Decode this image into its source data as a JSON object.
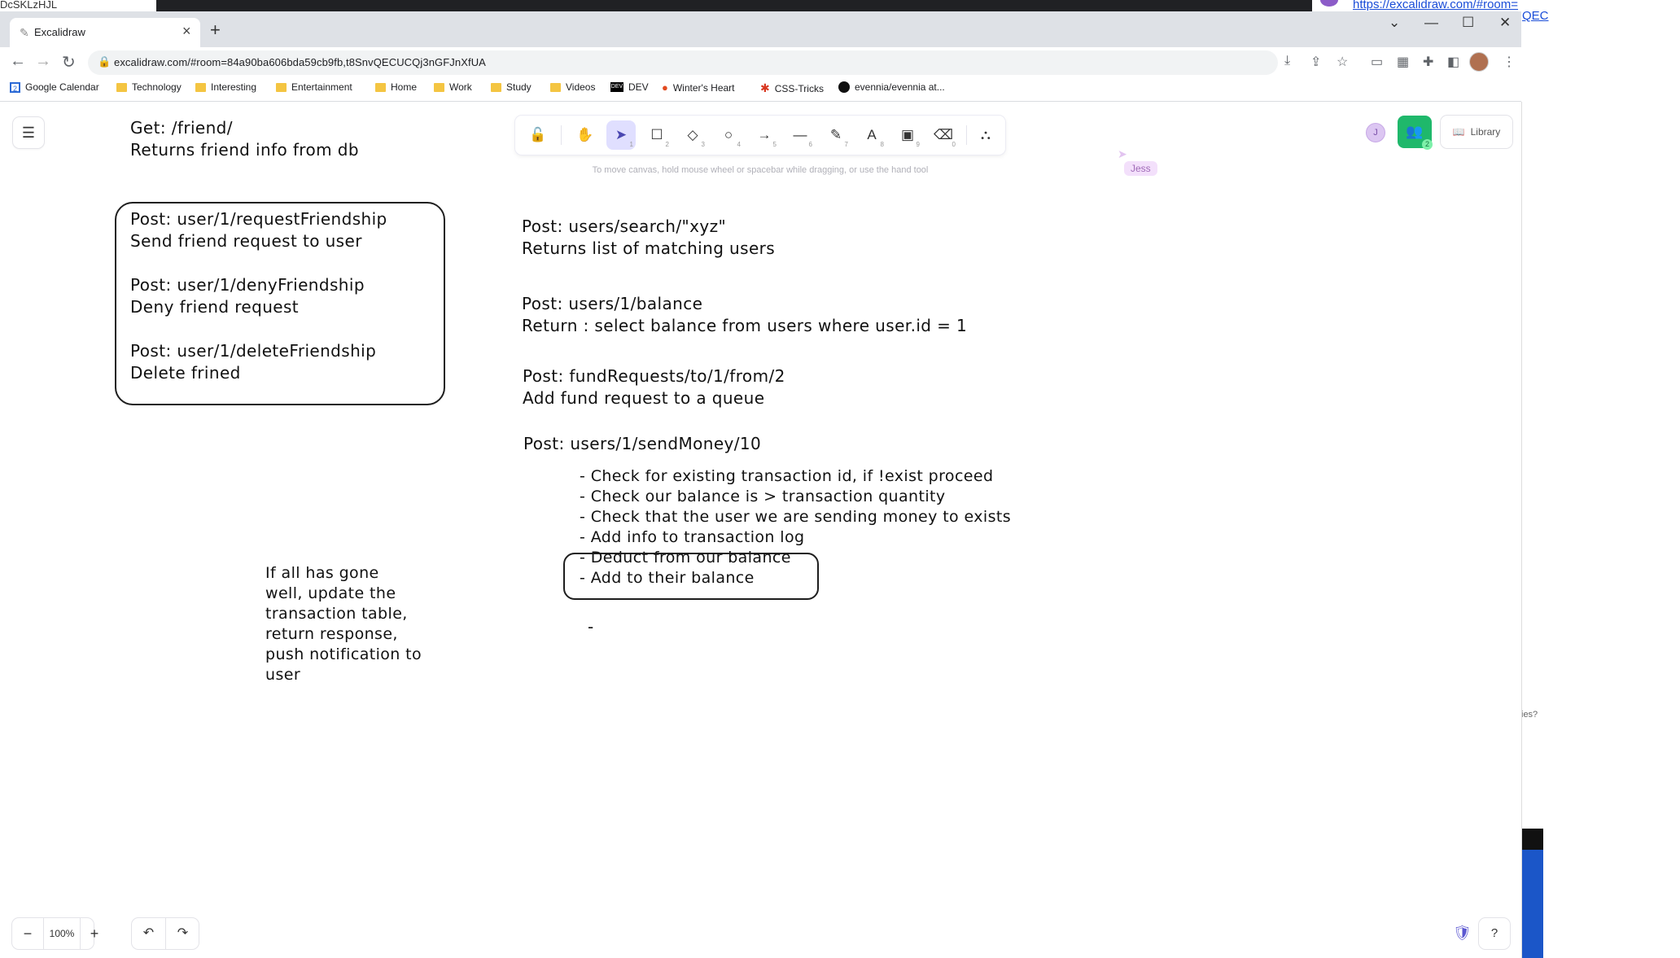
{
  "background": {
    "left_code": "DcSKLzHJL",
    "right_link": "https://excalidraw.com/#room=",
    "right_link_2": "QEC",
    "right_fragment": "ies?"
  },
  "browser": {
    "tab_title": "Excalidraw",
    "url": "excalidraw.com/#room=84a90ba606bda59cb9fb,t8SnvQECUCQj3nGFJnXfUA",
    "bookmarks": [
      {
        "label": "Google Calendar",
        "icon": "google-calendar-icon"
      },
      {
        "label": "Technology",
        "icon": "folder-icon"
      },
      {
        "label": "Interesting",
        "icon": "folder-icon"
      },
      {
        "label": "Entertainment",
        "icon": "folder-icon"
      },
      {
        "label": "Home",
        "icon": "folder-icon"
      },
      {
        "label": "Work",
        "icon": "folder-icon"
      },
      {
        "label": "Study",
        "icon": "folder-icon"
      },
      {
        "label": "Videos",
        "icon": "folder-icon"
      },
      {
        "label": "DEV",
        "icon": "dev-icon"
      },
      {
        "label": "Winter's Heart",
        "icon": "flame-icon"
      },
      {
        "label": "CSS-Tricks",
        "icon": "css-tricks-icon"
      },
      {
        "label": "evennia/evennia at...",
        "icon": "github-icon"
      }
    ]
  },
  "excalidraw": {
    "toolbar_hint": "To move canvas, hold mouse wheel or spacebar while dragging, or use the hand tool",
    "collaborator_tag": "Jess",
    "collaborator_initial": "J",
    "collab_count": "2",
    "library_label": "Library",
    "zoom_label": "100%",
    "tools": [
      {
        "name": "lock-icon",
        "key": ""
      },
      {
        "name": "hand-icon",
        "key": ""
      },
      {
        "name": "selection-icon",
        "key": "1"
      },
      {
        "name": "rectangle-icon",
        "key": "2"
      },
      {
        "name": "diamond-icon",
        "key": "3"
      },
      {
        "name": "ellipse-icon",
        "key": "4"
      },
      {
        "name": "arrow-icon",
        "key": "5"
      },
      {
        "name": "line-icon",
        "key": "6"
      },
      {
        "name": "pencil-icon",
        "key": "7"
      },
      {
        "name": "text-icon",
        "key": "8"
      },
      {
        "name": "image-icon",
        "key": "9"
      },
      {
        "name": "eraser-icon",
        "key": "0"
      },
      {
        "name": "shapes-library-icon",
        "key": ""
      }
    ]
  },
  "notes": {
    "get_friend": "Get: /friend/\nReturns friend info from db",
    "friendship_box": "Post: user/1/requestFriendship\nSend friend request to user\n\nPost: user/1/denyFriendship\nDeny friend request\n\nPost: user/1/deleteFriendship\nDelete frined",
    "search": "Post: users/search/\"xyz\"\nReturns list of matching users",
    "balance": "Post: users/1/balance\nReturn : select balance from users where user.id = 1",
    "fund_requests": "Post: fundRequests/to/1/from/2\nAdd fund request to a queue",
    "send_money": "Post: users/1/sendMoney/10",
    "checklist": "- Check for existing transaction id, if !exist proceed\n- Check our balance is > transaction quantity\n- Check that the user we are sending money to exists\n- Add info to transaction log\n- Deduct from our balance\n- Add to their balance",
    "dash": "-",
    "summary": "If all has gone\nwell, update the\ntransaction table,\nreturn response,\npush notification to\nuser"
  }
}
